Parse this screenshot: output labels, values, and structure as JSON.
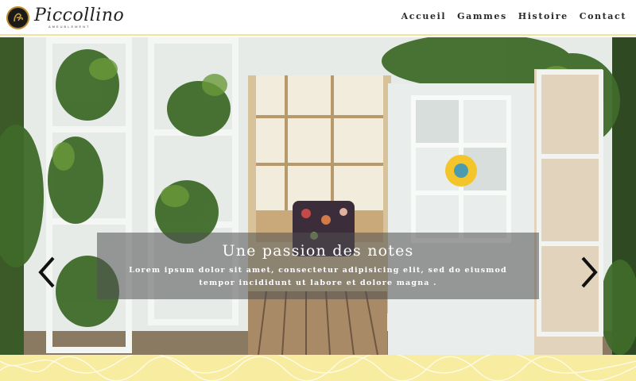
{
  "brand": {
    "name": "Piccollino",
    "tagline": "AMEUBLEMENT"
  },
  "nav": {
    "items": [
      {
        "label": "Accueil"
      },
      {
        "label": "Gammes"
      },
      {
        "label": "Histoire"
      },
      {
        "label": "Contact"
      }
    ]
  },
  "hero": {
    "title": "Une passion des notes",
    "text": "Lorem ipsum dolor sit amet, consectetur adipisicing elit, sed do eiusmod tempor incididunt ut labore et dolore magna .",
    "prev_icon": "chevron-left-icon",
    "next_icon": "chevron-right-icon"
  },
  "colors": {
    "accent_yellow": "#f7ec9f",
    "logo_gold": "#b88a2a",
    "nav_text": "#2a2a2a"
  }
}
